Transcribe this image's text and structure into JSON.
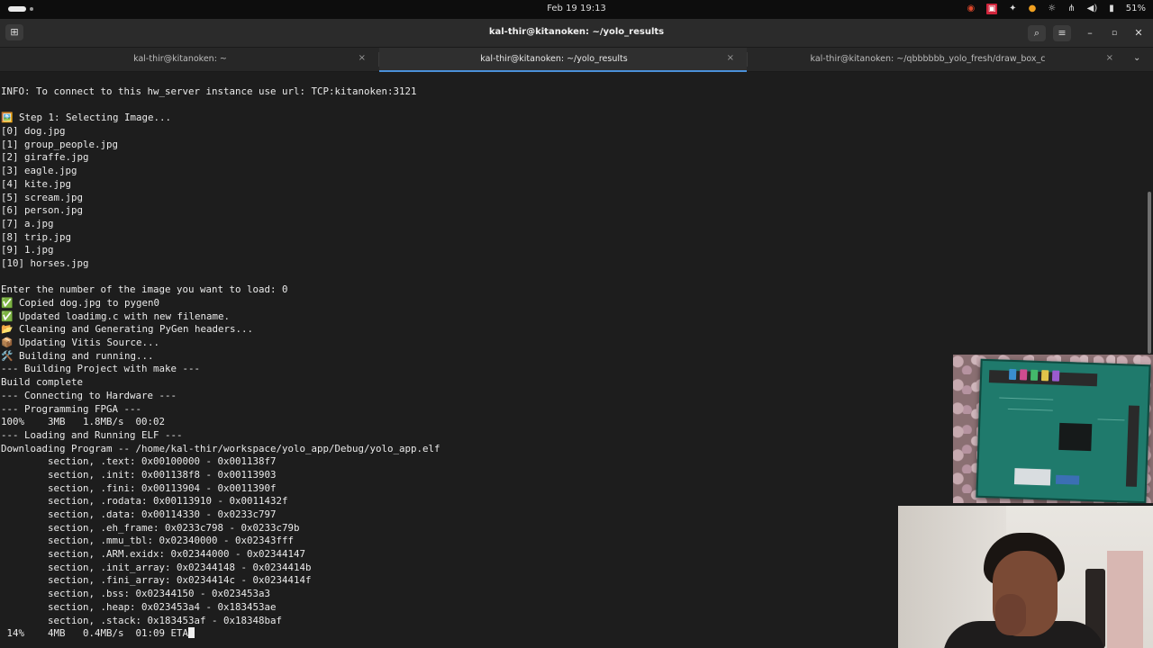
{
  "topbar": {
    "clock": "Feb 19  19:13",
    "battery": "51%",
    "tray_icons": [
      "ubuntu-icon",
      "red-app-icon",
      "accessibility-icon",
      "mic-icon",
      "brightness-icon",
      "network-icon",
      "volume-icon",
      "battery-icon"
    ]
  },
  "window": {
    "title": "kal-thir@kitanoken: ~/yolo_results",
    "new_tab_glyph": "⊞",
    "search_glyph": "⌕",
    "menu_glyph": "≡",
    "minimize_glyph": "–",
    "maximize_glyph": "▫",
    "close_glyph": "✕"
  },
  "tabs": [
    {
      "label": "kal-thir@kitanoken: ~",
      "close": "×"
    },
    {
      "label": "kal-thir@kitanoken: ~/yolo_results",
      "close": "×"
    },
    {
      "label": "kal-thir@kitanoken: ~/qbbbbbb_yolo_fresh/draw_box_c",
      "close": "×"
    }
  ],
  "tabs_overflow": "⌄",
  "terminal": {
    "lines": [
      "INFO: To connect to this hw_server instance use url: TCP:kitanoken:3121",
      "",
      "🖼️ Step 1: Selecting Image...",
      "[0] dog.jpg",
      "[1] group_people.jpg",
      "[2] giraffe.jpg",
      "[3] eagle.jpg",
      "[4] kite.jpg",
      "[5] scream.jpg",
      "[6] person.jpg",
      "[7] a.jpg",
      "[8] trip.jpg",
      "[9] 1.jpg",
      "[10] horses.jpg",
      "",
      "Enter the number of the image you want to load: 0",
      "✅ Copied dog.jpg to pygen0",
      "✅ Updated loadimg.c with new filename.",
      "📂 Cleaning and Generating PyGen headers...",
      "📦 Updating Vitis Source...",
      "🛠️ Building and running...",
      "--- Building Project with make ---",
      "Build complete",
      "--- Connecting to Hardware ---",
      "--- Programming FPGA ---",
      "100%    3MB   1.8MB/s  00:02",
      "--- Loading and Running ELF ---",
      "Downloading Program -- /home/kal-thir/workspace/yolo_app/Debug/yolo_app.elf",
      "        section, .text: 0x00100000 - 0x001138f7",
      "        section, .init: 0x001138f8 - 0x00113903",
      "        section, .fini: 0x00113904 - 0x0011390f",
      "        section, .rodata: 0x00113910 - 0x0011432f",
      "        section, .data: 0x00114330 - 0x0233c797",
      "        section, .eh_frame: 0x0233c798 - 0x0233c79b",
      "        section, .mmu_tbl: 0x02340000 - 0x02343fff",
      "        section, .ARM.exidx: 0x02344000 - 0x02344147",
      "        section, .init_array: 0x02344148 - 0x0234414b",
      "        section, .fini_array: 0x0234414c - 0x0234414f",
      "        section, .bss: 0x02344150 - 0x023453a3",
      "        section, .heap: 0x023453a4 - 0x183453ae",
      "        section, .stack: 0x183453af - 0x18348baf"
    ],
    "progress_line": " 14%    4MB   0.4MB/s  01:09 ETA"
  }
}
